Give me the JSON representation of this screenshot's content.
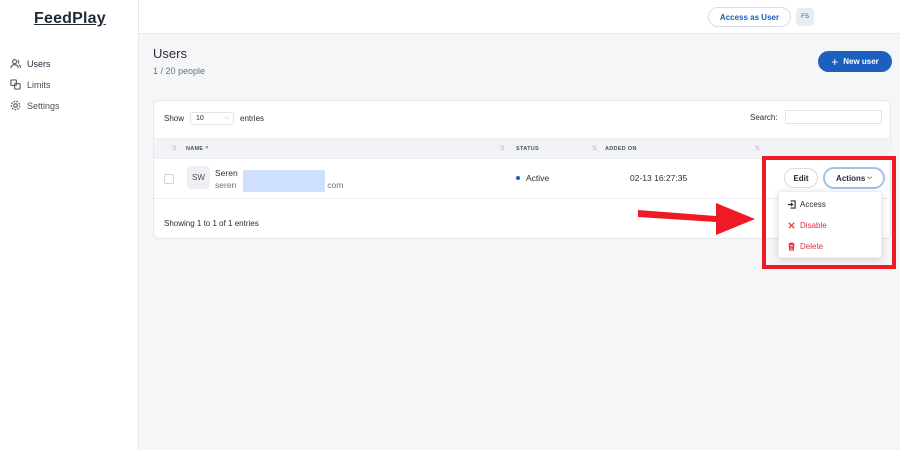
{
  "brand": "FeedPlay",
  "sidebar": {
    "items": [
      {
        "label": "Users",
        "icon": "users-icon"
      },
      {
        "label": "Limits",
        "icon": "limits-icon"
      },
      {
        "label": "Settings",
        "icon": "gear-icon"
      }
    ]
  },
  "topbar": {
    "access_label": "Access as User",
    "avatar_initials": "FS"
  },
  "page": {
    "title": "Users",
    "subtitle": "1 / 20 people",
    "new_user_label": "New user"
  },
  "table": {
    "show_label": "Show",
    "entries_label": "entries",
    "page_size": "10",
    "search_label": "Search:",
    "columns": [
      "NAME",
      "STATUS",
      "ADDED ON"
    ],
    "rows": [
      {
        "initials": "SW",
        "name": "Seren",
        "email_prefix": "seren",
        "email_suffix": "com",
        "status": "Active",
        "added_on": "02-13 16:27:35",
        "edit_label": "Edit",
        "actions_label": "Actions"
      }
    ],
    "footer": "Showing 1 to 1 of 1 entries"
  },
  "actions_menu": {
    "items": [
      "Access",
      "Disable",
      "Delete"
    ]
  },
  "colors": {
    "accent": "#1b5fbf",
    "danger": "#d9363e",
    "annotation": "#ee1b24"
  }
}
